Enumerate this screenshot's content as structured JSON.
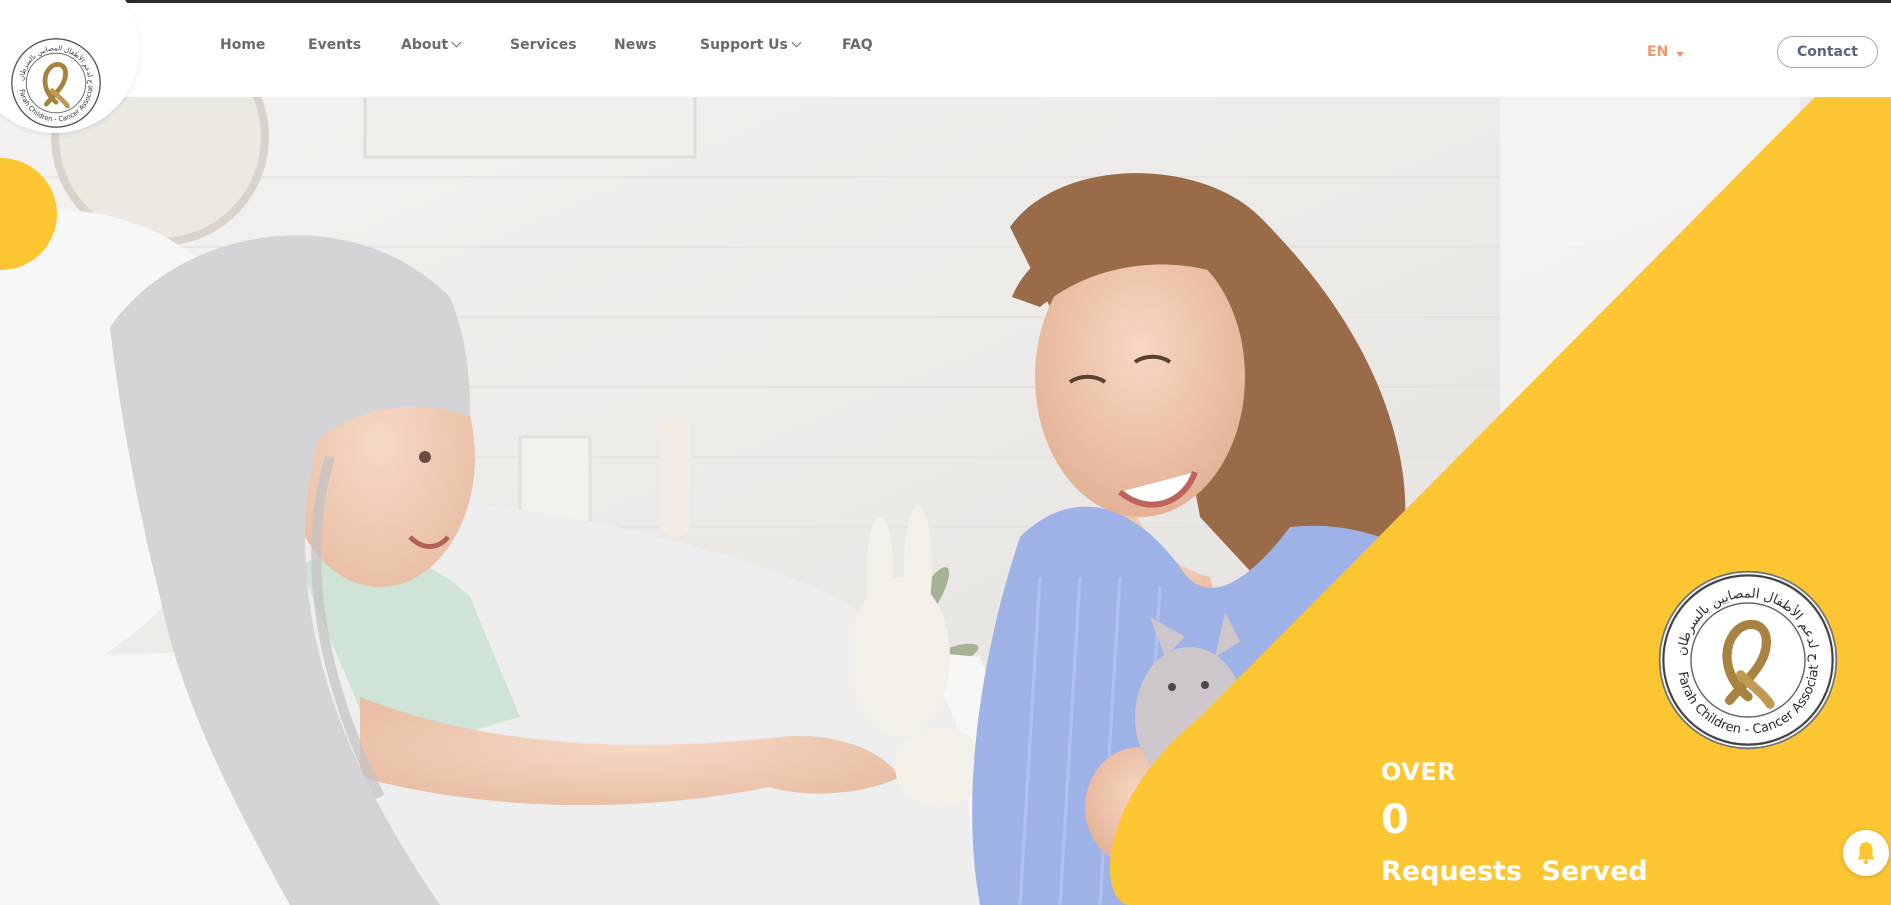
{
  "header": {
    "logo_alt": "Farah Children Cancer Association",
    "nav": [
      {
        "label": "Home"
      },
      {
        "label": "Events"
      },
      {
        "label": "About",
        "dropdown": true
      },
      {
        "label": "Services"
      },
      {
        "label": "News"
      },
      {
        "label": "Support Us",
        "dropdown": true
      },
      {
        "label": "FAQ"
      }
    ],
    "language": "EN",
    "contact_label": "Contact"
  },
  "hero": {
    "counter_prefix": "OVER",
    "counter_value": "0",
    "counter_label": "Requests  Served"
  },
  "logo": {
    "arabic_text": "جمعية فرح لدعم الأطفال المصابين بالسرطان",
    "english_text": "Farah Children - Cancer Association"
  },
  "icons": {
    "chevron": "chevron-down-icon",
    "bell": "bell-icon",
    "ribbon": "ribbon-icon"
  },
  "colors": {
    "accent_yellow": "#fcc532",
    "nav_text": "#6a6a6a",
    "lang_text": "#e9986a",
    "contact_text": "#5b6380",
    "ribbon_gold": "#a8833f"
  }
}
